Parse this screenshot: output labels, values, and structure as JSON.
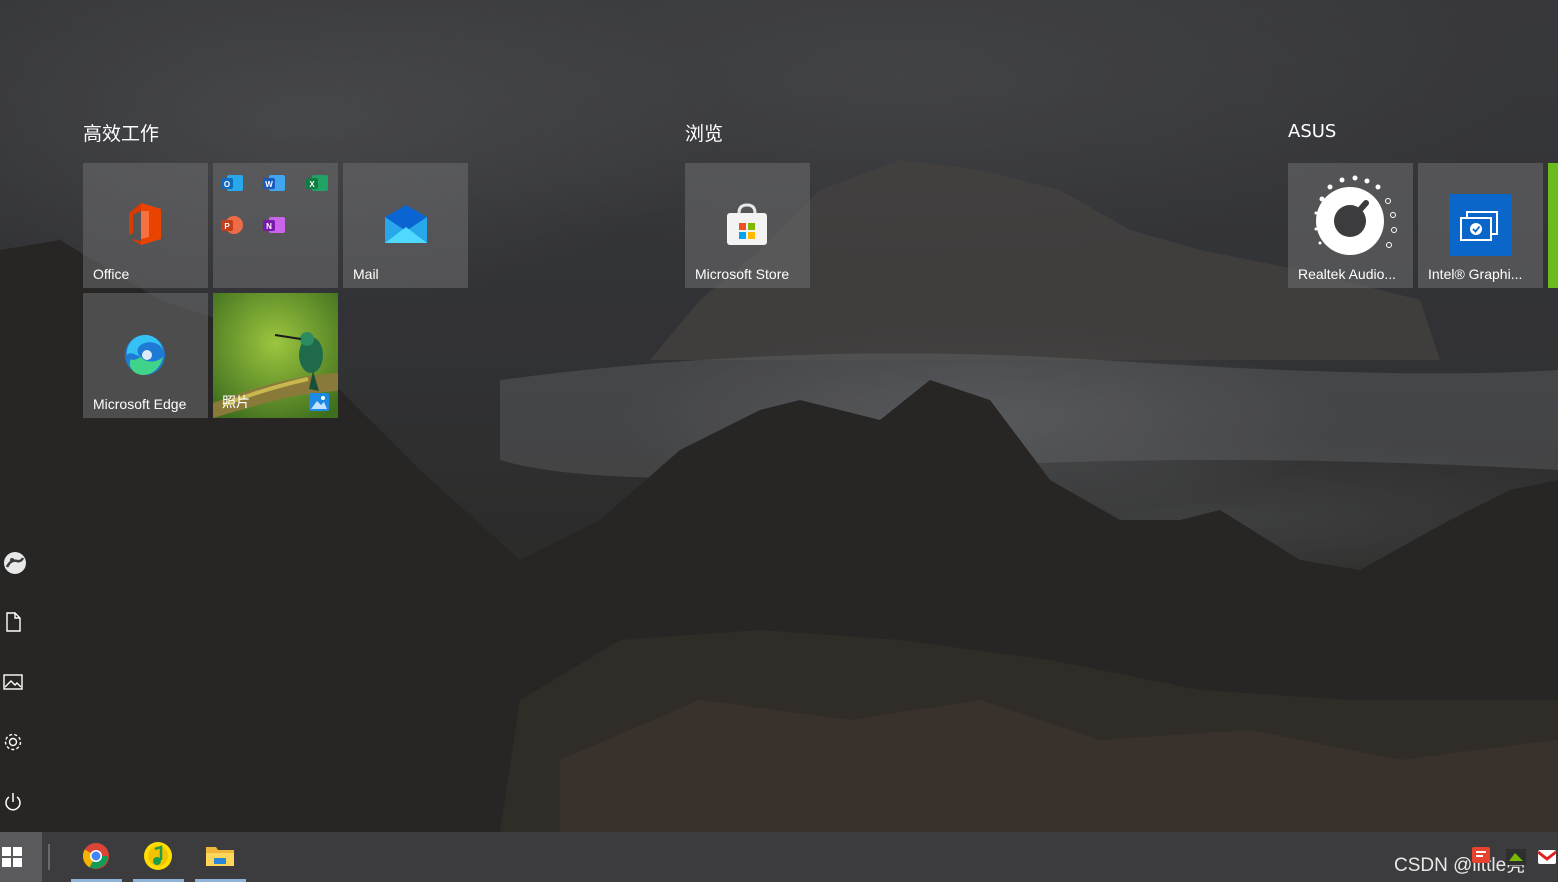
{
  "groups": [
    {
      "title": "高效工作"
    },
    {
      "title": "浏览"
    },
    {
      "title": "ASUS"
    }
  ],
  "tiles": {
    "office": "Office",
    "mail": "Mail",
    "edge": "Microsoft Edge",
    "photos": "照片",
    "store": "Microsoft Store",
    "realtek": "Realtek Audio...",
    "intel": "Intel® Graphi..."
  },
  "office_suite_apps": [
    "O",
    "W",
    "X",
    "P",
    "N"
  ],
  "rail": [
    "user-icon",
    "documents-icon",
    "pictures-icon",
    "settings-icon",
    "power-icon"
  ],
  "taskbar": {
    "apps": [
      "chrome-icon",
      "music-app-icon",
      "file-explorer-icon"
    ],
    "tray_text": "CSDN @little亮"
  },
  "colors": {
    "office_red": "#d83b01",
    "outlook_blue": "#0f6cbd",
    "word_blue": "#185abd",
    "excel_green": "#107c41",
    "ppt_orange": "#c43e1c",
    "onenote_purple": "#7719aa",
    "intel_blue": "#0a66c8",
    "taskbar_indicator": "#8fb3d9"
  }
}
